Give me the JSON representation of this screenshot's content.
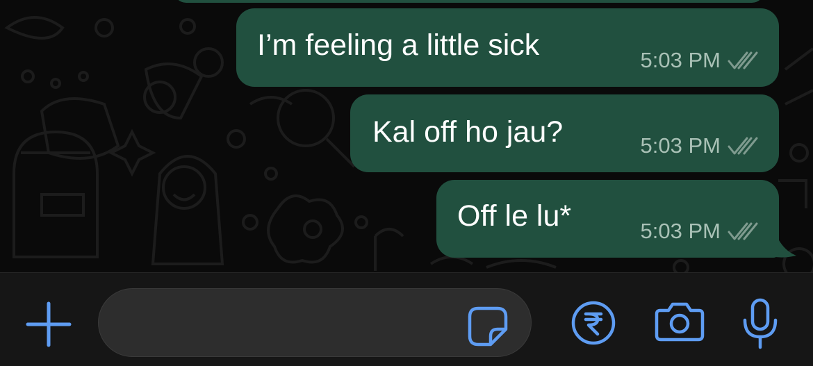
{
  "messages": [
    {
      "text": "I’m feeling a little sick",
      "time": "5:03 PM",
      "status_icon": "double-check-icon"
    },
    {
      "text": "Kal off ho jau?",
      "time": "5:03 PM",
      "status_icon": "double-check-icon"
    },
    {
      "text": "Off le lu*",
      "time": "5:03 PM",
      "status_icon": "double-check-icon"
    }
  ],
  "input_bar": {
    "message_placeholder": "",
    "attach_icon": "plus-icon",
    "sticker_icon": "sticker-icon",
    "payment_icon": "rupee-icon",
    "camera_icon": "camera-icon",
    "mic_icon": "microphone-icon"
  },
  "colors": {
    "outgoing_bubble": "#21503f",
    "accent_blue": "#5e9cf2",
    "chat_background": "#0a0a0a",
    "input_bar_background": "#161616"
  }
}
